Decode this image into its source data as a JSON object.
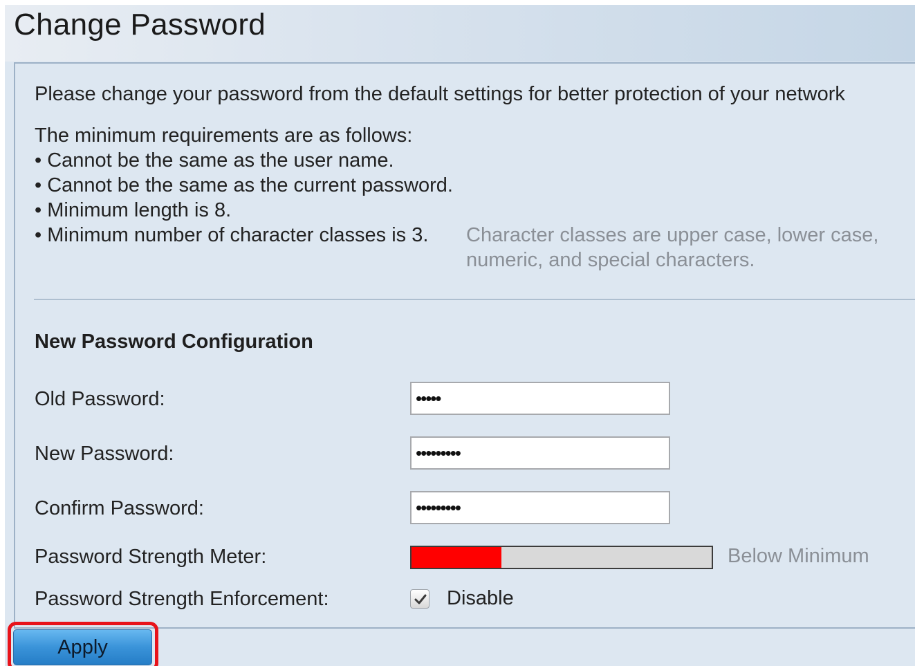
{
  "page": {
    "title": "Change Password"
  },
  "intro": "Please change your password from the default settings for better protection of your network",
  "requirements": {
    "heading": "The minimum requirements are as follows:",
    "items": [
      "Cannot be the same as the user name.",
      "Cannot be the same as the current password.",
      "Minimum length is 8.",
      "Minimum number of character classes is 3."
    ],
    "char_class_note": "Character classes are upper case, lower case, numeric, and special characters."
  },
  "config": {
    "section_title": "New Password Configuration",
    "old_password": {
      "label": "Old Password:",
      "value": "•••••"
    },
    "new_password": {
      "label": "New Password:",
      "value": "•••••••••"
    },
    "confirm_password": {
      "label": "Confirm Password:",
      "value": "•••••••••"
    },
    "strength_meter": {
      "label": "Password Strength Meter:",
      "level": 0.3,
      "status": "Below Minimum",
      "fill_color": "#ff0000"
    },
    "enforcement": {
      "label": "Password Strength Enforcement:",
      "checkbox_label": "Disable",
      "checked": true
    }
  },
  "actions": {
    "apply_label": "Apply"
  }
}
